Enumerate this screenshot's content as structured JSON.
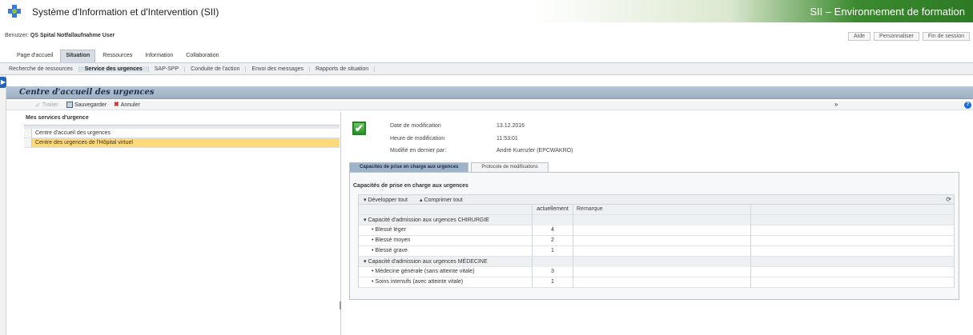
{
  "app": {
    "title": "Système d'Information et d'Intervention (SII)",
    "environment": "SII – Environnement de formation"
  },
  "user": {
    "label": "Benutzer",
    "name": "QS Spital Notfallaufnahme User"
  },
  "top_links": [
    "Aide",
    "Personnaliser",
    "Fin de session"
  ],
  "main_tabs": [
    {
      "label": "Page d'accueil",
      "active": false
    },
    {
      "label": "Situation",
      "active": true
    },
    {
      "label": "Ressources",
      "active": false
    },
    {
      "label": "Information",
      "active": false
    },
    {
      "label": "Collaboration",
      "active": false
    }
  ],
  "sub_nav": [
    {
      "label": "Recherche de ressources",
      "active": false
    },
    {
      "label": "Service des urgences",
      "active": true
    },
    {
      "label": "SAP-SPP",
      "active": false
    },
    {
      "label": "Conduite de l'action",
      "active": false
    },
    {
      "label": "Envoi des messages",
      "active": false
    },
    {
      "label": "Rapports de situation",
      "active": false
    }
  ],
  "page": {
    "title": "Centre d'accueil des urgences"
  },
  "toolbar": {
    "traiter": "Traiter",
    "save": "Sauvegarder",
    "cancel": "Annuler",
    "collapse_icon": "»"
  },
  "left": {
    "title": "Mes services d'urgence",
    "items": [
      {
        "label": "Centre d'accueil des urgences",
        "selected": false
      },
      {
        "label": "Centre des urgences de l'Hôpital virtuel",
        "selected": true
      }
    ]
  },
  "meta": {
    "date_label": "Date de modification",
    "date_value": "13.12.2016",
    "time_label": "Heure de modification",
    "time_value": "11:53:01",
    "by_label": "Modifié en dernier par:",
    "by_value": "André Kuenzler (EPCWAKRO)"
  },
  "detail_tabs": [
    {
      "label": "Capacités de prise en charge aux urgences",
      "active": true
    },
    {
      "label": "Protocole de modifications",
      "active": false
    }
  ],
  "capacities": {
    "title": "Capacités de prise en charge aux urgences",
    "expand_all": "Développer tout",
    "collapse_all": "Comprimer tout",
    "col_current": "actuellement",
    "col_remark": "Remarque",
    "groups": [
      {
        "label": "Capacité d'admission aux urgences CHIRURGIE",
        "rows": [
          {
            "label": "Blessé léger",
            "value": "4"
          },
          {
            "label": "Blessé moyen",
            "value": "2"
          },
          {
            "label": "Blessé grave",
            "value": "1"
          }
        ]
      },
      {
        "label": "Capacité d'admission aux urgences MÉDECINE",
        "rows": [
          {
            "label": "Médecine générale (sans atteinte vitale)",
            "value": "3"
          },
          {
            "label": "Soins intensifs (avec atteinte vitale)",
            "value": "1"
          }
        ]
      }
    ]
  },
  "colors": {
    "accent_green": "#2d7a24",
    "selected_row": "#fcd97a",
    "title_bar": "#9fb0c4"
  }
}
